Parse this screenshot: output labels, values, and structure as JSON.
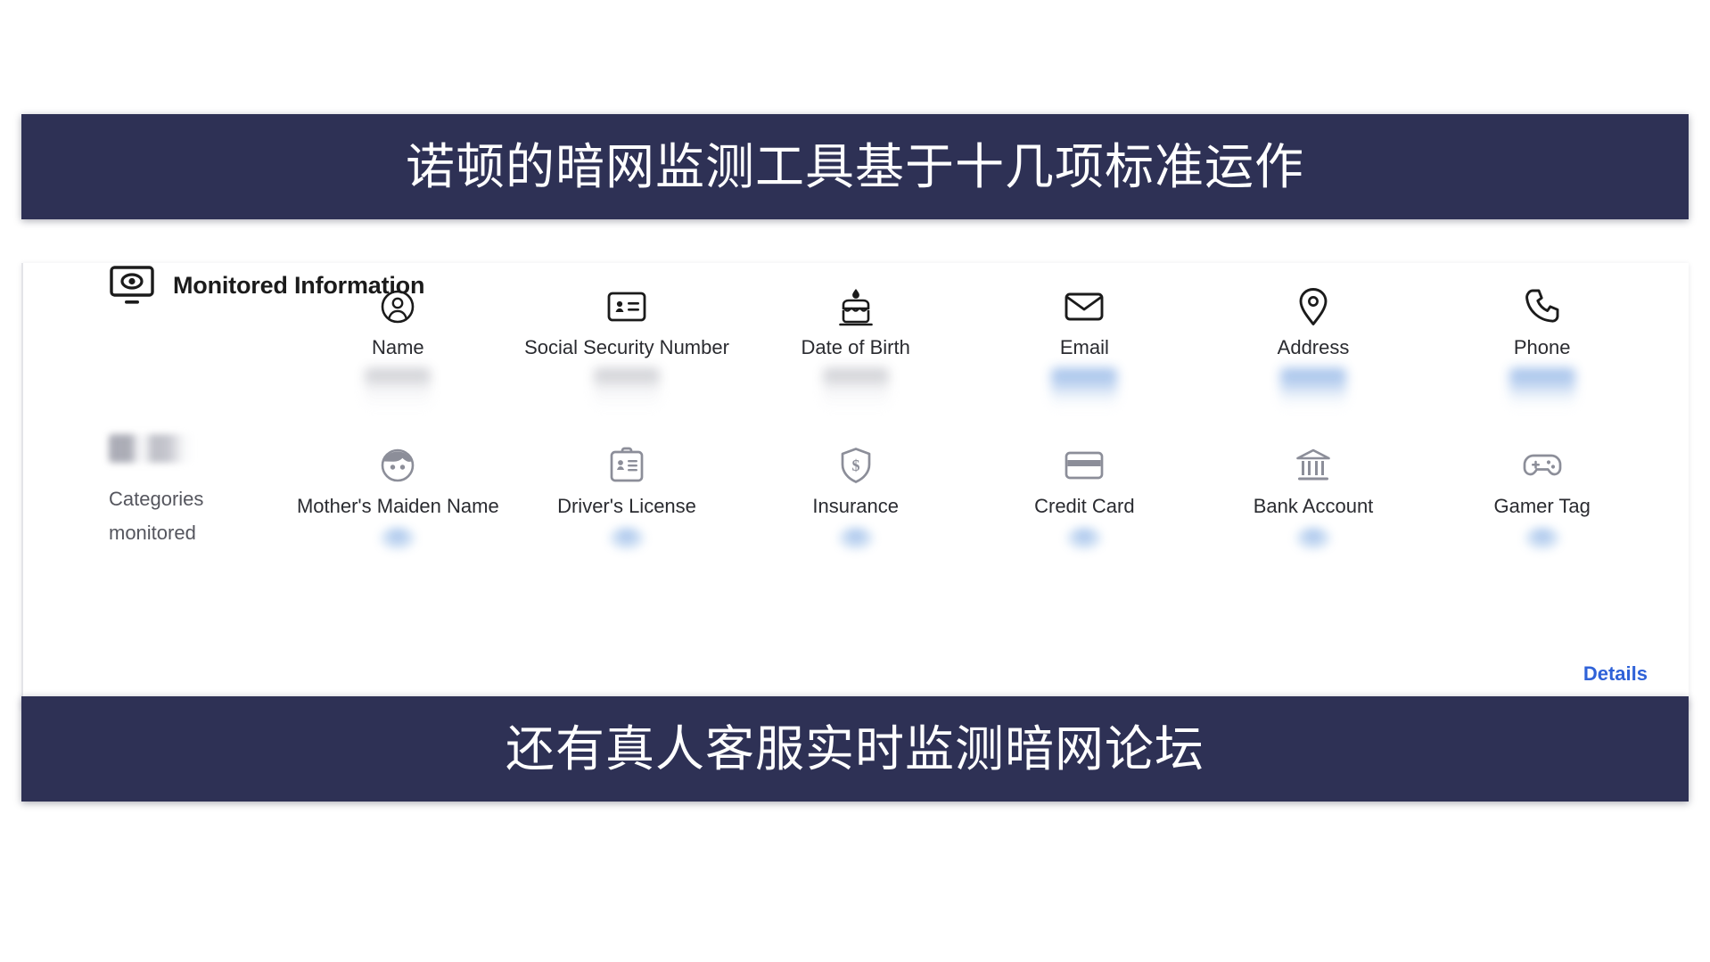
{
  "banners": {
    "top": "诺顿的暗网监测工具基于十几项标准运作",
    "bottom": "还有真人客服实时监测暗网论坛"
  },
  "panel": {
    "icon": "monitor-eye-icon",
    "title": "Monitored Information",
    "details_link": "Details",
    "left_column": {
      "value_redacted": "",
      "label_line1": "Categories",
      "label_line2": "monitored"
    },
    "rows": [
      {
        "items": [
          {
            "icon": "person-circle-icon",
            "label": "Name",
            "value_redacted": "",
            "value_style": "gray"
          },
          {
            "icon": "id-card-icon",
            "label": "Social Security Number",
            "value_redacted": "",
            "value_style": "gray"
          },
          {
            "icon": "birthday-cake-icon",
            "label": "Date of Birth",
            "value_redacted": "",
            "value_style": "gray"
          },
          {
            "icon": "envelope-icon",
            "label": "Email",
            "value_redacted": "",
            "value_style": "blue"
          },
          {
            "icon": "location-pin-icon",
            "label": "Address",
            "value_redacted": "",
            "value_style": "blue"
          },
          {
            "icon": "phone-icon",
            "label": "Phone",
            "value_redacted": "",
            "value_style": "blue"
          }
        ]
      },
      {
        "items": [
          {
            "icon": "face-icon",
            "label": "Mother's Maiden Name",
            "value_redacted": "",
            "value_style": "dot"
          },
          {
            "icon": "drivers-license-icon",
            "label": "Driver's License",
            "value_redacted": "",
            "value_style": "dot"
          },
          {
            "icon": "shield-dollar-icon",
            "label": "Insurance",
            "value_redacted": "",
            "value_style": "dot"
          },
          {
            "icon": "credit-card-icon",
            "label": "Credit Card",
            "value_redacted": "",
            "value_style": "dot"
          },
          {
            "icon": "bank-icon",
            "label": "Bank Account",
            "value_redacted": "",
            "value_style": "dot"
          },
          {
            "icon": "gamepad-icon",
            "label": "Gamer Tag",
            "value_redacted": "",
            "value_style": "dot"
          }
        ]
      }
    ]
  },
  "colors": {
    "banner_background": "#2e3155",
    "banner_text": "#ffffff",
    "link": "#2f62d8",
    "icon_dark": "#1b1b1b",
    "icon_muted": "#8c8e99",
    "label_text": "#2a2b30"
  }
}
